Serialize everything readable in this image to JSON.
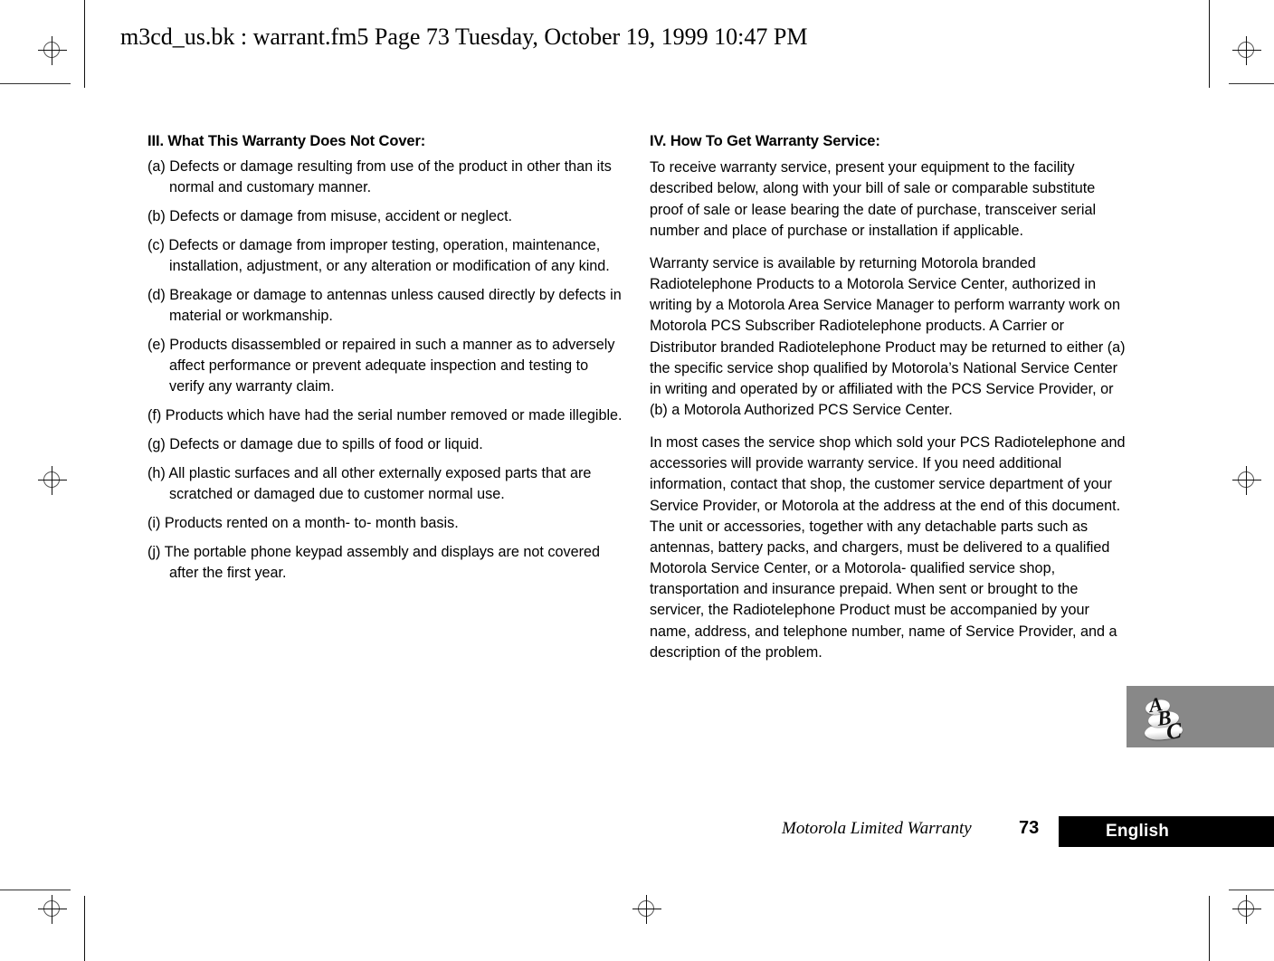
{
  "header": {
    "file_info": "m3cd_us.bk : warrant.fm5  Page 73  Tuesday, October 19, 1999  10:47 PM"
  },
  "left_column": {
    "heading": "III. What This Warranty Does Not Cover:",
    "items": [
      "(a) Defects or damage resulting from use of the product in other than its normal and customary manner.",
      "(b) Defects or damage from misuse, accident or neglect.",
      "(c) Defects or damage from improper testing, operation, maintenance, installation, adjustment, or any alteration or modification of any kind.",
      "(d) Breakage or damage to antennas unless caused directly by defects in material or workmanship.",
      "(e) Products disassembled or repaired in such a manner as to adversely affect performance or prevent adequate inspection and testing to verify any warranty claim.",
      "(f) Products which have had the serial number removed or made illegible.",
      "(g) Defects or damage due to spills of food or liquid.",
      "(h) All plastic surfaces and all other externally exposed parts that are scratched or damaged due to customer normal use.",
      "(i) Products rented on a month- to- month basis.",
      "(j) The portable phone keypad assembly and displays are not covered after the first year."
    ]
  },
  "right_column": {
    "heading": "IV. How To Get Warranty Service:",
    "paragraphs": [
      "To receive warranty service, present your equipment to the facility described below, along with your bill of sale or comparable substitute proof of sale or lease bearing the date of purchase, transceiver serial number and place of purchase or installation if applicable.",
      "Warranty service is available by returning Motorola branded Radiotelephone Products to a Motorola Service Center, authorized in writing by a Motorola Area Service Manager to perform warranty work on Motorola PCS Subscriber Radiotelephone products. A Carrier or Distributor branded Radiotelephone Product may be returned to either (a) the specific service shop qualified by Motorola’s National Service Center in writing and operated by or affiliated with the PCS Service Provider, or (b) a Motorola Authorized PCS Service Center.",
      "In most cases the service shop which sold your PCS Radiotelephone and accessories will provide warranty service. If you need additional information, contact that shop, the customer service department of your Service Provider, or Motorola at the address at the end of this document. The unit or accessories, together with any detachable parts such as antennas, battery packs, and chargers, must be delivered to a qualified Motorola Service Center, or a Motorola- qualified service shop, transportation and insurance prepaid. When sent or brought to the servicer, the Radiotelephone Product must be accompanied by your name, address, and telephone number, name of Service Provider, and a description of the problem."
    ]
  },
  "logo": {
    "letter_a": "A",
    "letter_b": "B",
    "letter_c": "C",
    "background_color": "#888888"
  },
  "footer": {
    "chapter_title": "Motorola Limited Warranty",
    "page_number": "73",
    "language": "English",
    "tab_color": "#000000"
  }
}
